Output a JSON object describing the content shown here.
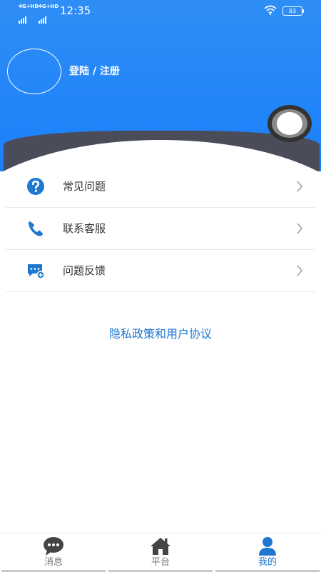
{
  "status_bar": {
    "network_1": "4G+HD",
    "network_2": "4G+HD",
    "time": "12:35",
    "battery": "83"
  },
  "profile": {
    "login_label": "登陆 / 注册"
  },
  "menu": {
    "items": [
      {
        "label": "常见问题",
        "icon": "question-circle-icon"
      },
      {
        "label": "联系客服",
        "icon": "phone-icon"
      },
      {
        "label": "问题反馈",
        "icon": "feedback-chat-icon"
      }
    ]
  },
  "privacy_link": "隐私政策和用户协议",
  "tabbar": {
    "tabs": [
      {
        "label": "消息",
        "icon": "chat-bubble-icon",
        "active": false
      },
      {
        "label": "平台",
        "icon": "home-icon",
        "active": false
      },
      {
        "label": "我的",
        "icon": "user-icon",
        "active": true
      }
    ]
  },
  "colors": {
    "header_blue": "#1a80fb",
    "accent_blue": "#1e78d0",
    "dark_band": "#4b4c59"
  }
}
